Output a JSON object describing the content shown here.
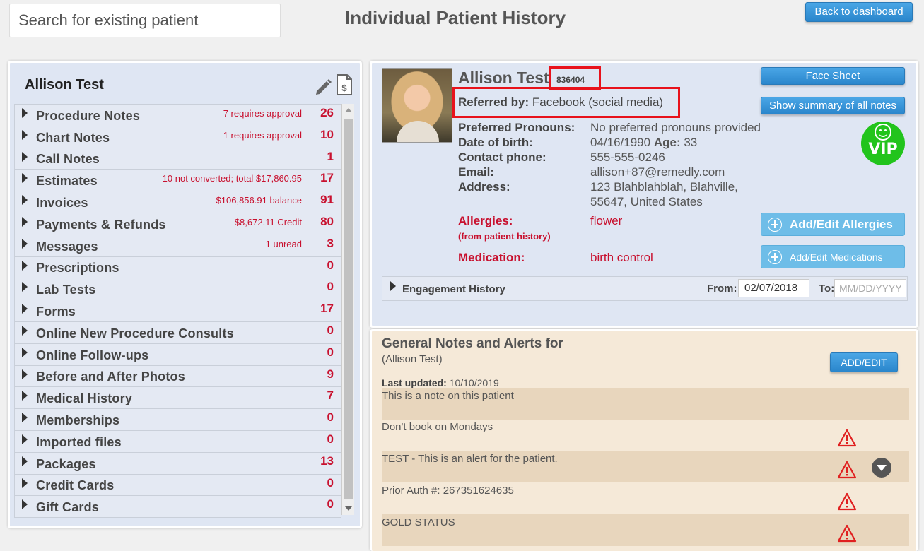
{
  "search": {
    "placeholder": "Search for existing patient"
  },
  "page_title": "Individual Patient History",
  "back_button": "Back to dashboard",
  "left_panel": {
    "patient_name": "Allison Test",
    "items": [
      {
        "label": "Procedure Notes",
        "note": "7 requires approval",
        "count": "26"
      },
      {
        "label": "Chart Notes",
        "note": "1 requires approval",
        "count": "10"
      },
      {
        "label": "Call Notes",
        "note": "",
        "count": "1"
      },
      {
        "label": "Estimates",
        "note": "10 not converted; total $17,860.95",
        "count": "17"
      },
      {
        "label": "Invoices",
        "note": "$106,856.91 balance",
        "count": "91"
      },
      {
        "label": "Payments & Refunds",
        "note": "$8,672.11 Credit",
        "count": "80"
      },
      {
        "label": "Messages",
        "note": "1 unread",
        "count": "3"
      },
      {
        "label": "Prescriptions",
        "note": "",
        "count": "0"
      },
      {
        "label": "Lab Tests",
        "note": "",
        "count": "0"
      },
      {
        "label": "Forms",
        "note": "",
        "count": "17"
      },
      {
        "label": "Online New Procedure Consults",
        "note": "",
        "count": "0"
      },
      {
        "label": "Online Follow-ups",
        "note": "",
        "count": "0"
      },
      {
        "label": "Before and After Photos",
        "note": "",
        "count": "9"
      },
      {
        "label": "Medical History",
        "note": "",
        "count": "7"
      },
      {
        "label": "Memberships",
        "note": "",
        "count": "0"
      },
      {
        "label": "Imported files",
        "note": "",
        "count": "0"
      },
      {
        "label": "Packages",
        "note": "",
        "count": "13"
      },
      {
        "label": "Credit Cards",
        "note": "",
        "count": "0"
      },
      {
        "label": "Gift Cards",
        "note": "",
        "count": "0"
      }
    ]
  },
  "patient": {
    "name": "Allison Test",
    "id": "836404",
    "referred_by_label": "Referred by:",
    "referred_by": "Facebook (social media)",
    "pronouns_label": "Preferred Pronouns:",
    "pronouns": "No preferred pronouns provided",
    "dob_label": "Date of birth:",
    "dob": "04/16/1990",
    "age_label": "Age:",
    "age": "33",
    "phone_label": "Contact phone:",
    "phone": "555-555-0246",
    "email_label": "Email:",
    "email": "allison+87@remedly.com",
    "address_label": "Address:",
    "address_line1": "123 Blahblahblah, Blahville,",
    "address_line2": "55647, United States",
    "allergies_label": "Allergies:",
    "allergies_sub": "(from patient history)",
    "allergies": "flower",
    "medication_label": "Medication:",
    "medication": "birth control",
    "vip": "VIP"
  },
  "buttons": {
    "face_sheet": "Face Sheet",
    "summary": "Show summary of all notes",
    "add_allergies": "Add/Edit Allergies",
    "add_medications": "Add/Edit Medications",
    "add_edit": "ADD/EDIT"
  },
  "engagement": {
    "label": "Engagement History",
    "from_label": "From:",
    "from_value": "02/07/2018",
    "to_label": "To:",
    "to_placeholder": "MM/DD/YYYY"
  },
  "notes": {
    "title": "General Notes and Alerts for",
    "subtitle": "(Allison Test)",
    "updated_label": "Last updated:",
    "updated": "10/10/2019",
    "rows": [
      {
        "text": "This is a note on this patient",
        "alert": false
      },
      {
        "text": "Don't book on Mondays",
        "alert": true
      },
      {
        "text": "TEST - This is an alert for the patient.",
        "alert": true
      },
      {
        "text": "Prior Auth #: 267351624635",
        "alert": true
      },
      {
        "text": "GOLD STATUS",
        "alert": true
      }
    ]
  },
  "colors": {
    "accent": "#2a86cc",
    "alert": "#c8102e",
    "highlight_box": "#e8121b",
    "vip": "#22c41c"
  }
}
